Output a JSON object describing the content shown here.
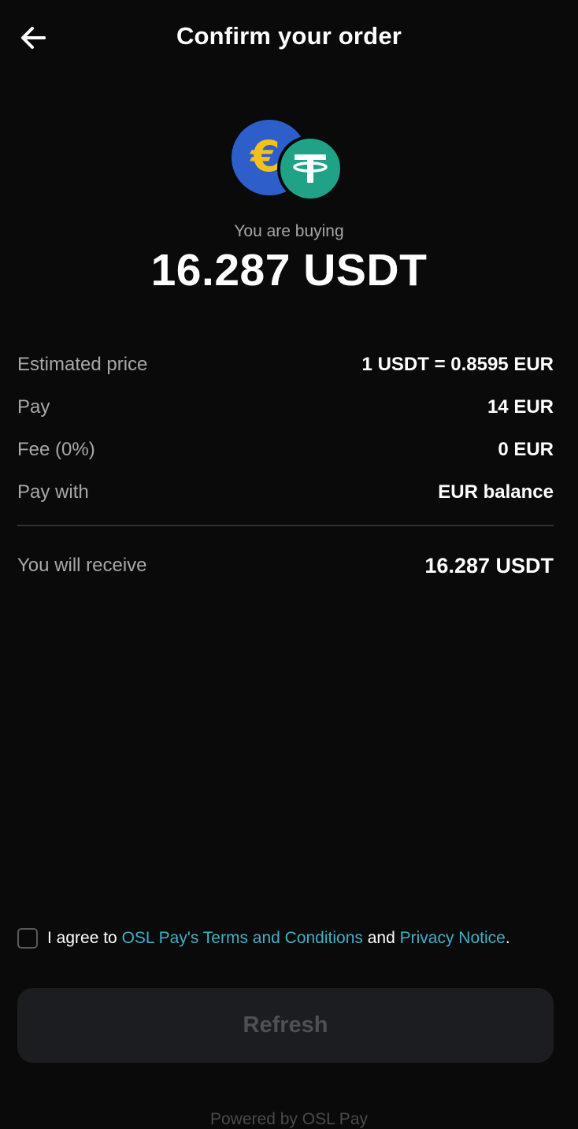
{
  "header": {
    "title": "Confirm your order",
    "back_icon": "arrow-left-icon"
  },
  "summary": {
    "coin_icons": [
      "euro-icon",
      "tether-icon"
    ],
    "coin_colors": {
      "euro": "#2d5ec9",
      "euro_symbol": "#f2c21a",
      "tether": "#1fa286"
    },
    "euro_symbol": "€",
    "label": "You are buying",
    "amount": "16.287 USDT"
  },
  "details": [
    {
      "label": "Estimated price",
      "value": "1 USDT = 0.8595 EUR"
    },
    {
      "label": "Pay",
      "value": "14 EUR"
    },
    {
      "label": "Fee (0%)",
      "value": "0 EUR"
    },
    {
      "label": "Pay with",
      "value": "EUR balance"
    }
  ],
  "receive": {
    "label": "You will receive",
    "value": "16.287 USDT"
  },
  "agreement": {
    "checked": false,
    "prefix": "I agree to ",
    "terms_link": "OSL Pay's Terms and Conditions",
    "middle": " and ",
    "privacy_link": "Privacy Notice",
    "suffix": ".",
    "link_color": "#3fb0c8"
  },
  "actions": {
    "refresh_label": "Refresh",
    "refresh_enabled": false
  },
  "footer": {
    "powered_by": "Powered by OSL Pay"
  }
}
